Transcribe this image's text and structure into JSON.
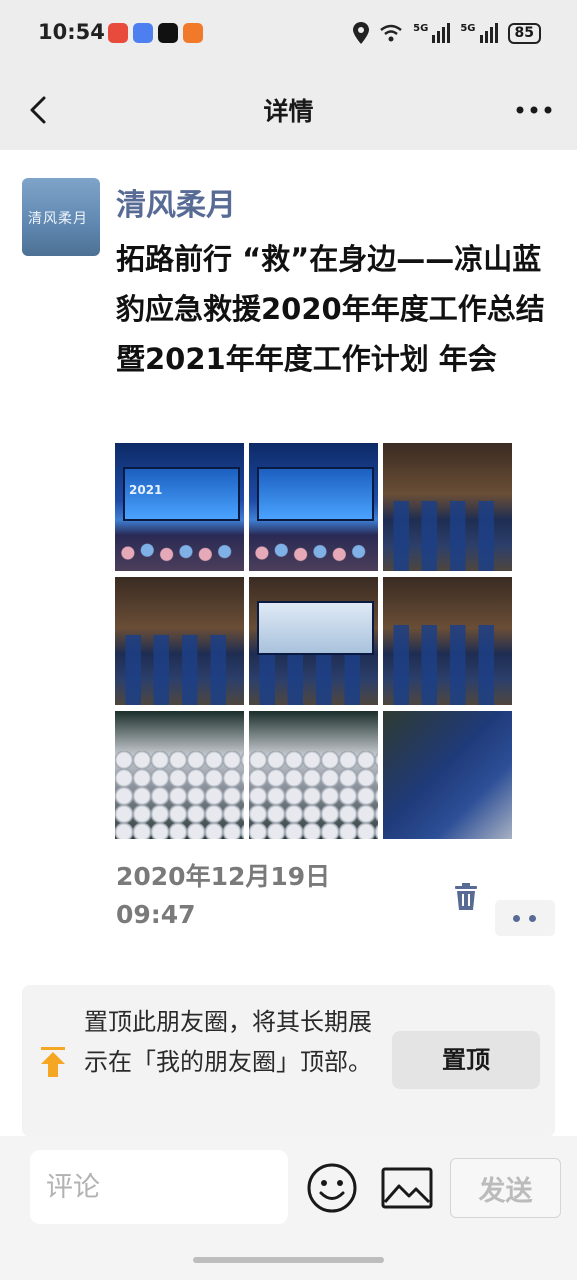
{
  "status_bar": {
    "time": "10:54",
    "network_1": "5G",
    "network_2": "5G",
    "battery": "85",
    "icons": [
      "location-icon",
      "wifi-icon",
      "signal-icon",
      "battery-icon"
    ]
  },
  "nav": {
    "title": "详情",
    "back_icon": "chevron-left-icon",
    "more_icon": "more-dots-icon"
  },
  "post": {
    "author": "清风柔月",
    "avatar_text": "清风柔月",
    "text": "拓路前行 “救”在身边——凉山蓝豹应急救援2020年年度工作总结 暨2021年年度工作计划 年会",
    "stage_caption": "2021",
    "photos": [
      "event-stage",
      "event-stage",
      "team-preparing",
      "team-in-hall",
      "screen-presentation",
      "team-uniforms",
      "badges-table",
      "badges-table",
      "blue-books"
    ],
    "timestamp": "2020年12月19日\n09:47",
    "colors": {
      "link": "#576b95",
      "team_blue": "#1c3f86"
    }
  },
  "pin": {
    "text": "置顶此朋友圈，将其长期展示在「我的朋友圈」顶部。",
    "button_label": "置顶"
  },
  "comment_bar": {
    "placeholder": "评论",
    "send_label": "发送"
  }
}
